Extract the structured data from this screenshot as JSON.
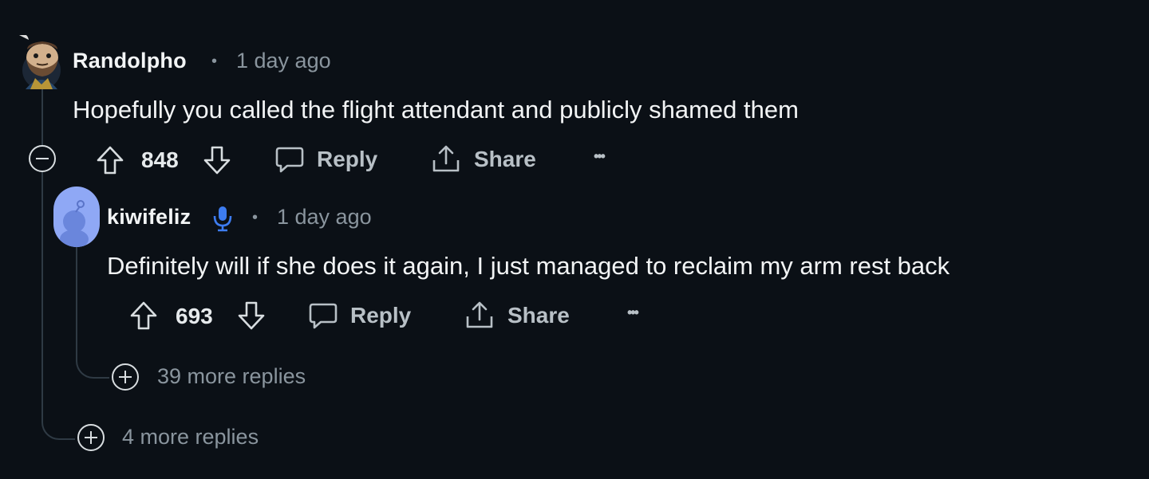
{
  "comments": [
    {
      "username": "Randolpho",
      "separator": "•",
      "time": "1 day ago",
      "text": "Hopefully you called the flight attendant and publicly shamed them",
      "score": "848",
      "reply_label": "Reply",
      "share_label": "Share",
      "more_label": "•••"
    },
    {
      "username": "kiwifeliz",
      "separator": "•",
      "time": "1 day ago",
      "text": "Definitely will if she does it again, I just managed to reclaim my arm rest back",
      "score": "693",
      "reply_label": "Reply",
      "share_label": "Share",
      "more_label": "•••",
      "badge_icon": "microphone-icon"
    }
  ],
  "more_replies": [
    {
      "label": "39 more replies"
    },
    {
      "label": "4 more replies"
    }
  ],
  "colors": {
    "background": "#0b1016",
    "text": "#f2f4f5",
    "muted": "#8a959e",
    "thread_line": "#2f3a44",
    "badge": "#3d7cf0",
    "kiwi_avatar": "#8fa8f5"
  }
}
